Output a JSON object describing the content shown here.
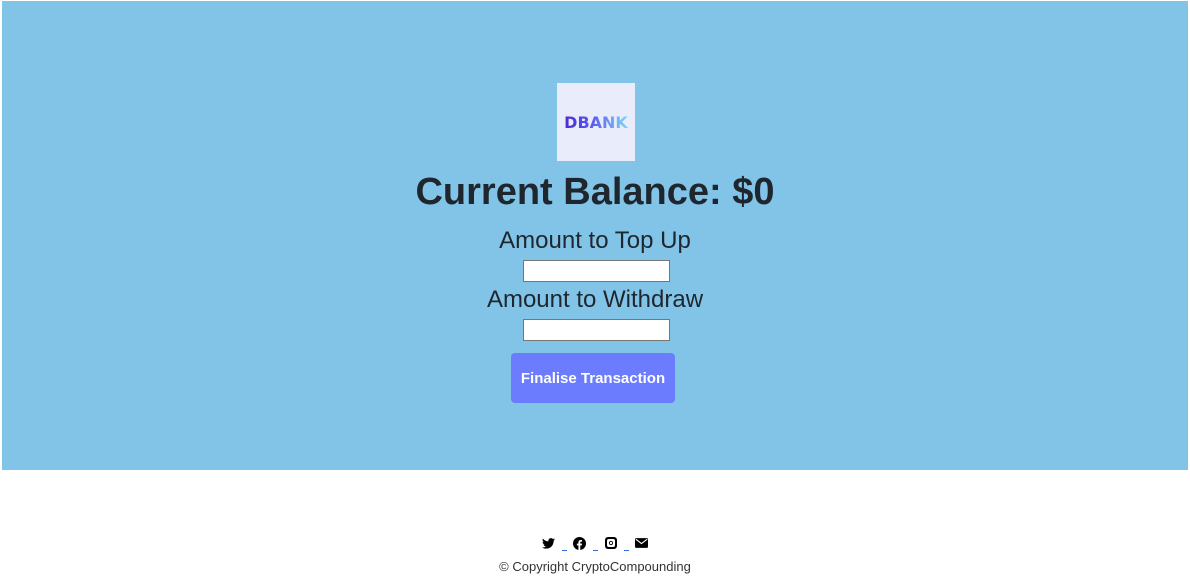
{
  "logo": {
    "text": "DBANK"
  },
  "balance": {
    "label": "Current Balance: $0"
  },
  "topup": {
    "label": "Amount to Top Up",
    "value": ""
  },
  "withdraw": {
    "label": "Amount to Withdraw",
    "value": ""
  },
  "submit": {
    "label": "Finalise Transaction"
  },
  "footer": {
    "social_icons": [
      "twitter-icon",
      "facebook-icon",
      "instagram-icon",
      "envelope-icon"
    ],
    "copyright": "© Copyright CryptoCompounding"
  },
  "colors": {
    "hero_bg": "#81c4e8",
    "button_bg": "#6b7cff",
    "text": "#1f262d"
  }
}
